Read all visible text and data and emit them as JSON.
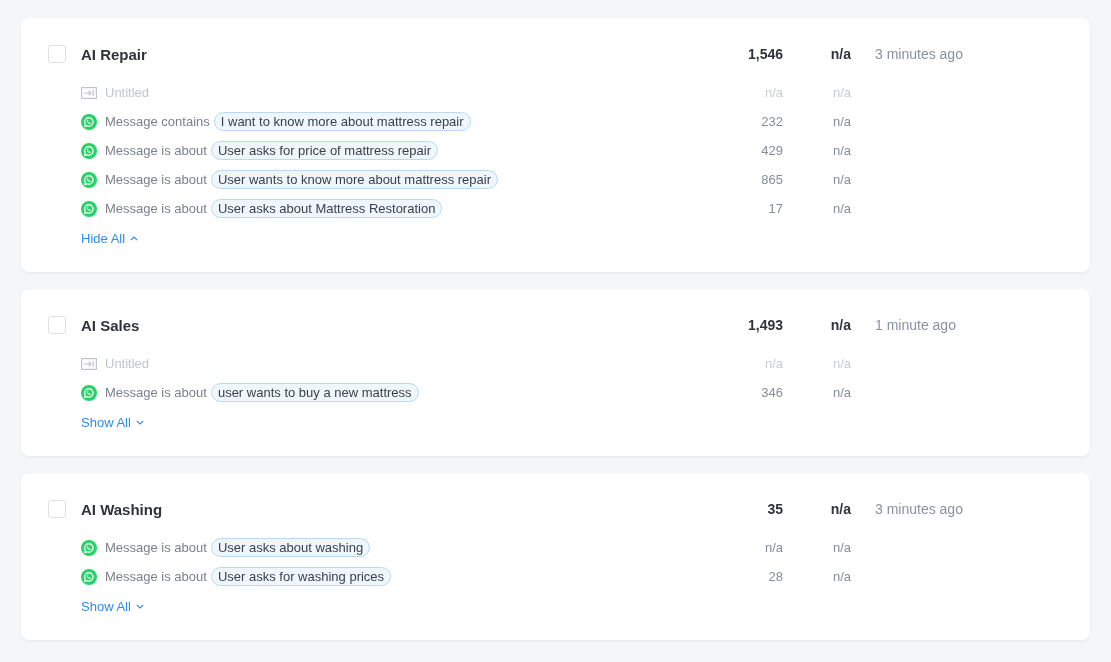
{
  "flows": [
    {
      "title": "AI Repair",
      "checked": false,
      "count": "1,546",
      "rate": "n/a",
      "updated": "3 minutes ago",
      "triggers": [
        {
          "kind": "untitled",
          "label": "Untitled",
          "count": "n/a",
          "rate": "n/a"
        },
        {
          "kind": "message",
          "condition": "Message contains",
          "value": "I want to know more about mattress repair",
          "count": "232",
          "rate": "n/a"
        },
        {
          "kind": "message",
          "condition": "Message is about",
          "value": "User asks for price of mattress repair",
          "count": "429",
          "rate": "n/a"
        },
        {
          "kind": "message",
          "condition": "Message is about",
          "value": "User wants to know more about mattress repair",
          "count": "865",
          "rate": "n/a"
        },
        {
          "kind": "message",
          "condition": "Message is about",
          "value": "User asks about Mattress Restoration",
          "count": "17",
          "rate": "n/a"
        }
      ],
      "toggle": {
        "label": "Hide All",
        "expanded": true
      }
    },
    {
      "title": "AI Sales",
      "checked": false,
      "count": "1,493",
      "rate": "n/a",
      "updated": "1 minute ago",
      "triggers": [
        {
          "kind": "untitled",
          "label": "Untitled",
          "count": "n/a",
          "rate": "n/a"
        },
        {
          "kind": "message",
          "condition": "Message is about",
          "value": "user wants to buy a new mattress",
          "count": "346",
          "rate": "n/a"
        }
      ],
      "toggle": {
        "label": "Show All",
        "expanded": false
      }
    },
    {
      "title": "AI Washing",
      "checked": false,
      "count": "35",
      "rate": "n/a",
      "updated": "3 minutes ago",
      "triggers": [
        {
          "kind": "message",
          "condition": "Message is about",
          "value": "User asks about washing",
          "count": "n/a",
          "rate": "n/a"
        },
        {
          "kind": "message",
          "condition": "Message is about",
          "value": "User asks for washing prices",
          "count": "28",
          "rate": "n/a"
        }
      ],
      "toggle": {
        "label": "Show All",
        "expanded": false
      }
    }
  ]
}
